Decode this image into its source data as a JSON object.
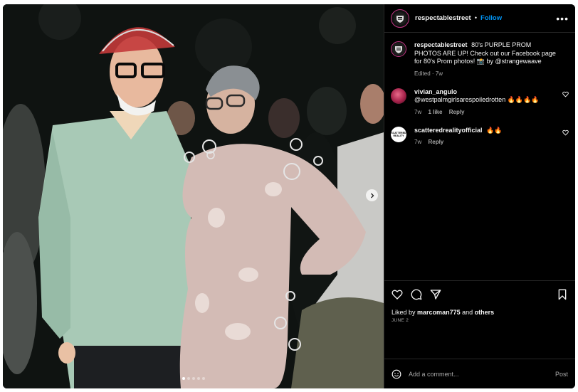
{
  "post": {
    "username": "respectablestreet",
    "separator": "•",
    "follow_label": "Follow",
    "more_label": "•••",
    "caption": "80's PURPLE PROM PHOTOS ARE UP! Check out our Facebook page for 80's Prom photos! 📸 by @strangewaave",
    "edited_label": "Edited · 7w",
    "carousel_dots": 5,
    "carousel_active": 0
  },
  "comments": [
    {
      "username": "vivian_angulo",
      "text": "@westpalmgirlsarespoiledrotten 🔥🔥🔥🔥",
      "age": "7w",
      "likes": "1 like",
      "reply": "Reply"
    },
    {
      "username": "scatteredrealityofficial",
      "text": "🔥🔥",
      "age": "7w",
      "reply": "Reply",
      "avatar_text": "SCATTERED REALITY"
    }
  ],
  "actions": {
    "liked_prefix": "Liked by",
    "liked_user": "marcoman775",
    "liked_and": "and",
    "liked_others": "others",
    "date": "JUNE 2"
  },
  "composer": {
    "placeholder": "Add a comment...",
    "post_label": "Post"
  },
  "colors": {
    "accent": "#0095f6",
    "panel_bg": "#000000",
    "muted": "#a8a8a8",
    "story_ring": "#c13584"
  },
  "icons": [
    "emoji-icon",
    "heart-icon",
    "comment-icon",
    "share-icon",
    "bookmark-icon",
    "chevron-right-icon"
  ]
}
